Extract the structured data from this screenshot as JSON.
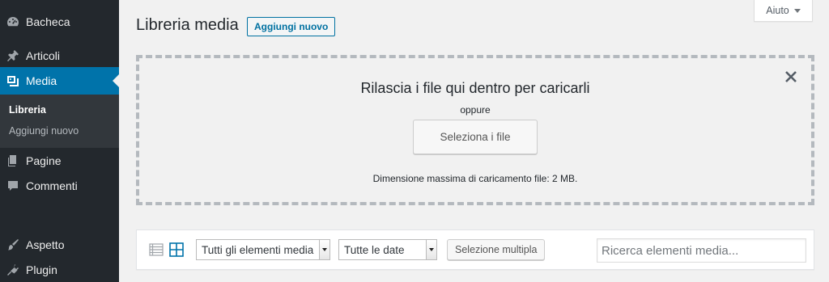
{
  "sidebar": {
    "items": [
      {
        "label": "Bacheca",
        "icon": "dashboard-icon"
      },
      {
        "label": "Articoli",
        "icon": "pin-icon"
      },
      {
        "label": "Media",
        "icon": "media-icon"
      },
      {
        "label": "Pagine",
        "icon": "page-icon"
      },
      {
        "label": "Commenti",
        "icon": "comment-icon"
      },
      {
        "label": "Aspetto",
        "icon": "brush-icon"
      },
      {
        "label": "Plugin",
        "icon": "plugin-icon"
      }
    ],
    "submenu": [
      {
        "label": "Libreria"
      },
      {
        "label": "Aggiungi nuovo"
      }
    ]
  },
  "help": {
    "label": "Aiuto"
  },
  "header": {
    "title": "Libreria media",
    "add_new_label": "Aggiungi nuovo"
  },
  "upload": {
    "instructions": "Rilascia i file qui dentro per caricarli",
    "or": "oppure",
    "select_label": "Seleziona i file",
    "max_size": "Dimensione massima di caricamento file: 2 MB."
  },
  "toolbar": {
    "type_filter": "Tutti gli elementi media",
    "date_filter": "Tutte le date",
    "bulk_select_label": "Selezione multipla",
    "search_placeholder": "Ricerca elementi media..."
  },
  "colors": {
    "sidebar_bg": "#23282d",
    "accent": "#0073aa",
    "submenu_bg": "#32373c",
    "page_bg": "#f1f1f1"
  }
}
